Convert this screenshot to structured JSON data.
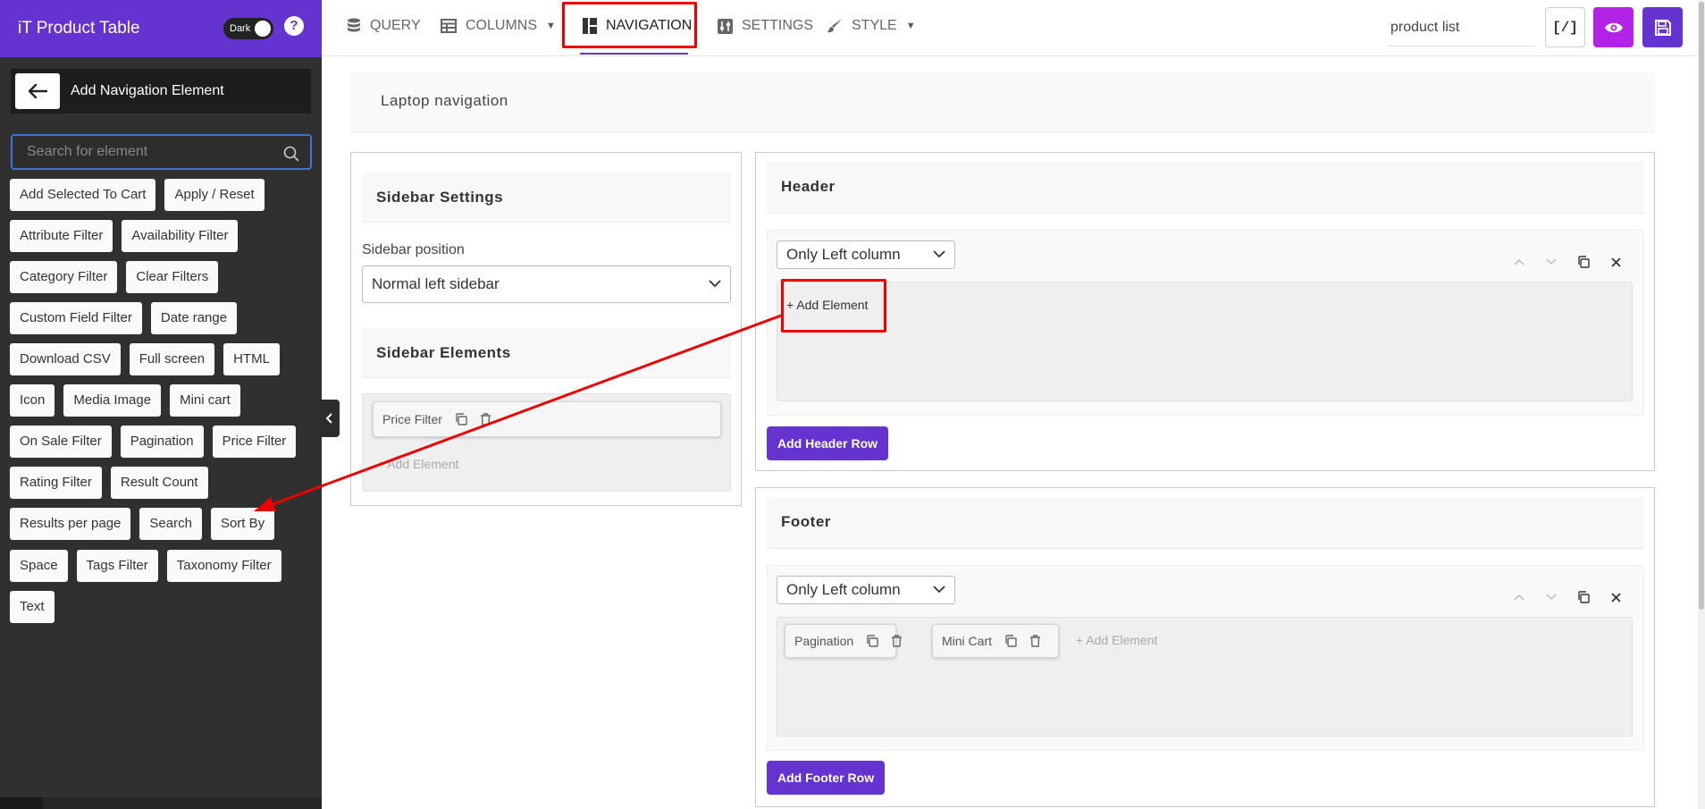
{
  "app": {
    "title": "iT Product Table",
    "dark_toggle_label": "Dark",
    "help_icon": "question-icon",
    "accent_color": "#6534d0"
  },
  "left_panel": {
    "header_label": "Add Navigation Element",
    "search": {
      "placeholder": "Search for element",
      "value": ""
    },
    "element_rows": [
      [
        "Add Selected To Cart",
        "Apply / Reset"
      ],
      [
        "Attribute Filter",
        "Availability Filter"
      ],
      [
        "Category Filter",
        "Clear Filters"
      ],
      [
        "Custom Field Filter",
        "Date range"
      ],
      [
        "Download CSV",
        "Full screen",
        "HTML"
      ],
      [
        "Icon",
        "Media Image",
        "Mini cart"
      ],
      [
        "On Sale Filter",
        "Pagination",
        "Price Filter"
      ],
      [
        "Rating Filter",
        "Result Count"
      ],
      [
        "Results per page",
        "Search",
        "Sort By"
      ],
      [
        "Space",
        "Tags Filter",
        "Taxonomy Filter"
      ],
      [
        "Text"
      ]
    ]
  },
  "tabs": [
    {
      "label": "QUERY",
      "icon": "database-icon"
    },
    {
      "label": "COLUMNS",
      "icon": "table-icon"
    },
    {
      "label": "NAVIGATION",
      "icon": "layout-icon",
      "active": true
    },
    {
      "label": "SETTINGS",
      "icon": "settings-sliders-icon"
    },
    {
      "label": "STYLE",
      "icon": "brush-icon"
    }
  ],
  "toolbar": {
    "table_title": "product list",
    "code_label": "[/]",
    "preview_color": "#b322e6",
    "save_color": "#6534d0"
  },
  "main": {
    "device_title": "Laptop navigation",
    "sidebar": {
      "settings_title": "Sidebar Settings",
      "position_label": "Sidebar position",
      "position_value": "Normal left sidebar",
      "elements_title": "Sidebar Elements",
      "elements": [
        "Price Filter"
      ],
      "add_label": "+ Add Element"
    },
    "header": {
      "title": "Header",
      "column_select": "Only Left column",
      "add_label": "+ Add Element",
      "add_row_label": "Add Header Row"
    },
    "footer": {
      "title": "Footer",
      "column_select": "Only Left column",
      "elements": [
        "Pagination",
        "Mini Cart"
      ],
      "add_label": "+ Add Element",
      "add_row_label": "Add Footer Row"
    }
  },
  "annotation_color": "#e00000"
}
